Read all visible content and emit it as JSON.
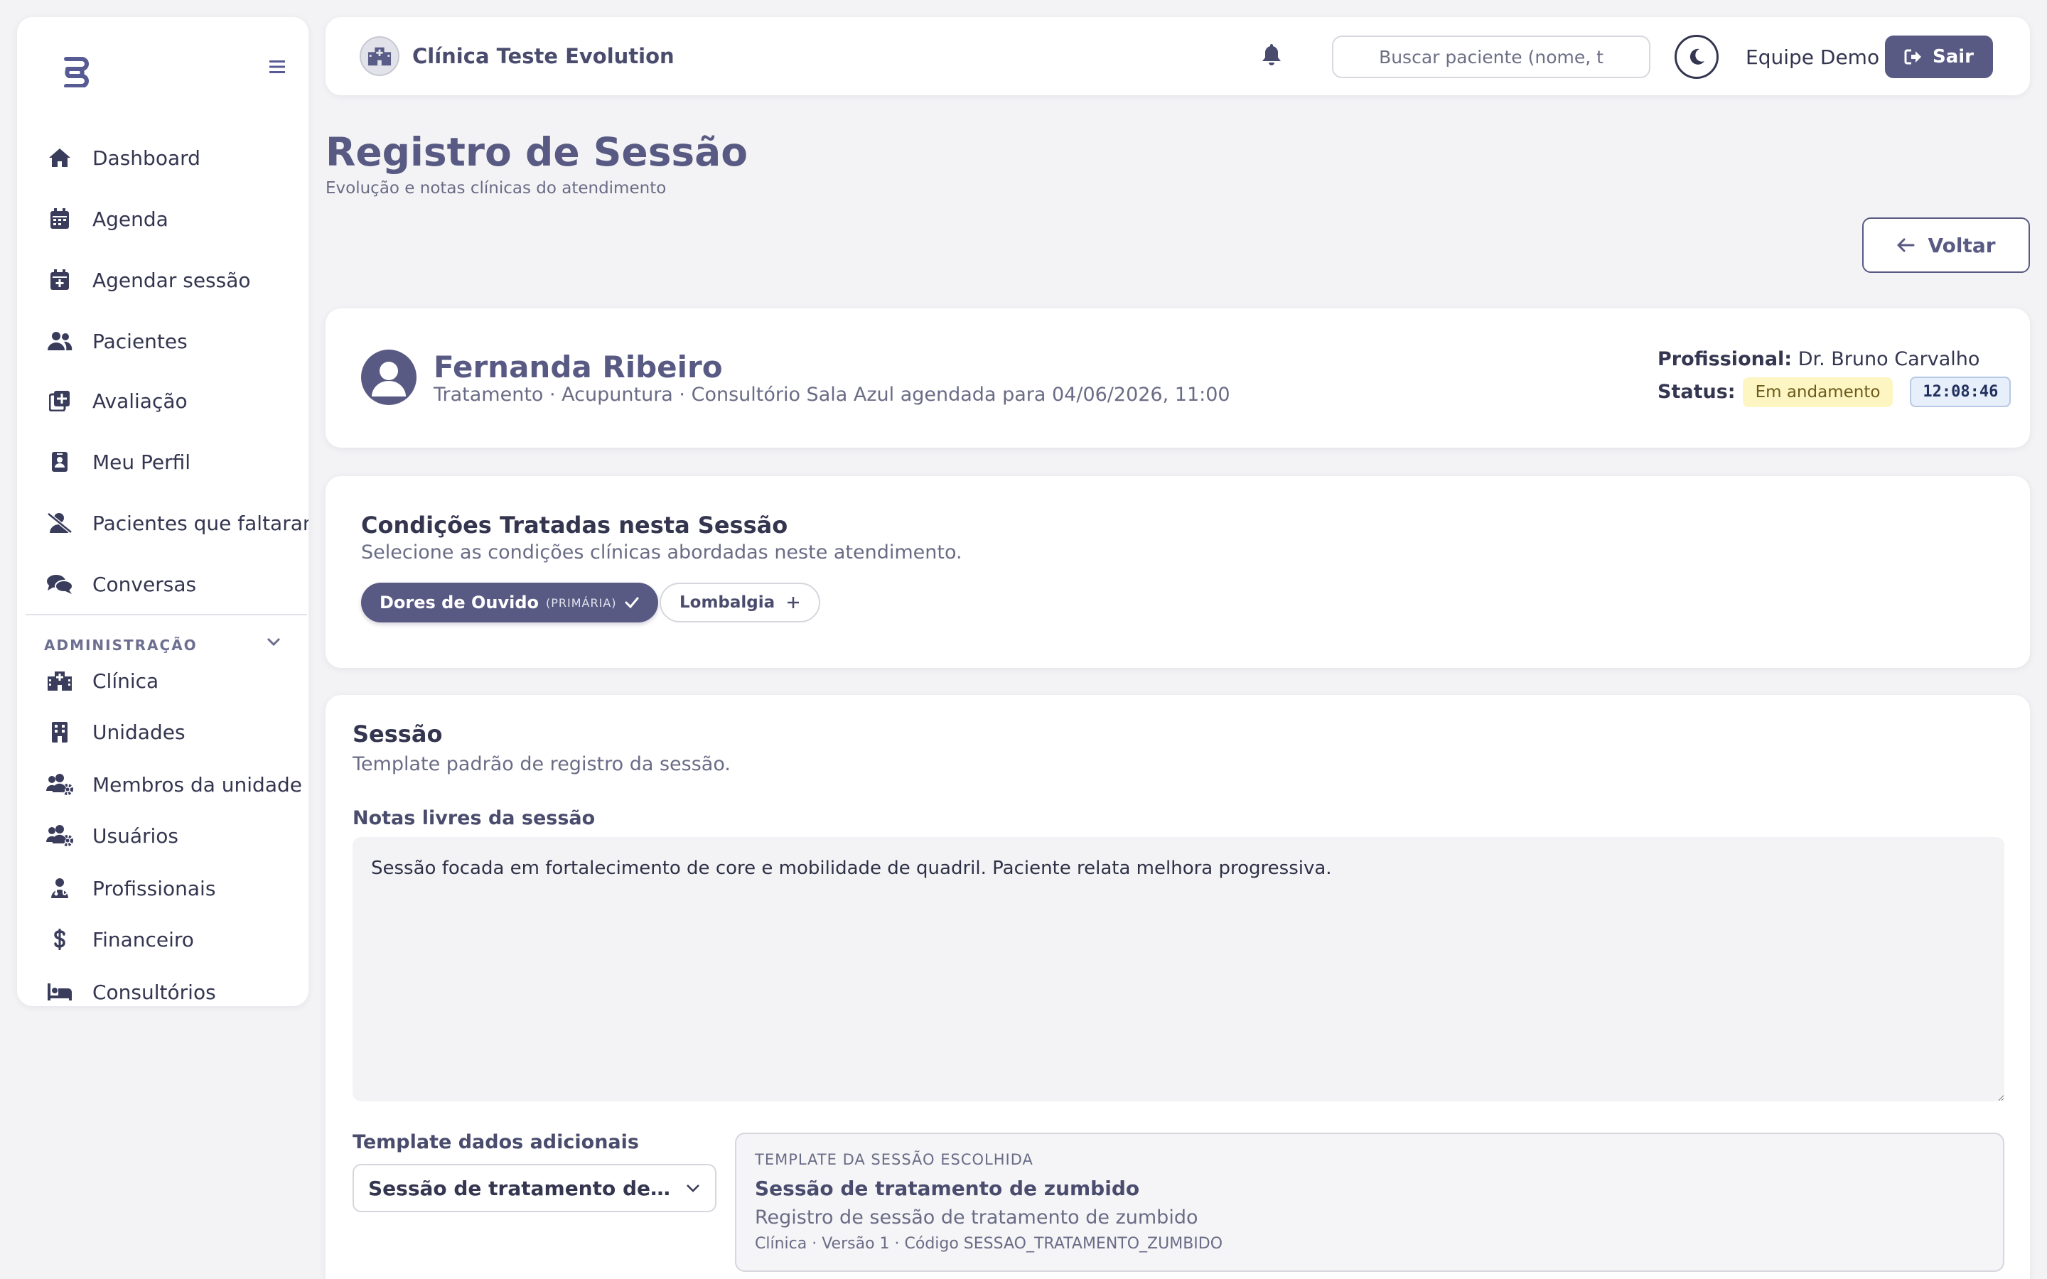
{
  "sidebar": {
    "logo_icon": "brand-logo-icon",
    "nav": [
      {
        "label": "Dashboard",
        "icon": "home-icon"
      },
      {
        "label": "Agenda",
        "icon": "calendar-icon"
      },
      {
        "label": "Agendar sessão",
        "icon": "calendar-plus-icon"
      },
      {
        "label": "Pacientes",
        "icon": "users-icon"
      },
      {
        "label": "Avaliação",
        "icon": "clipboard-plus-icon"
      },
      {
        "label": "Meu Perfil",
        "icon": "id-badge-icon"
      },
      {
        "label": "Pacientes que faltaram",
        "icon": "user-slash-icon"
      },
      {
        "label": "Conversas",
        "icon": "comments-icon"
      }
    ],
    "admin_section": "ADMINISTRAÇÃO",
    "admin": [
      {
        "label": "Clínica",
        "icon": "hospital-icon"
      },
      {
        "label": "Unidades",
        "icon": "building-icon"
      },
      {
        "label": "Membros da unidade",
        "icon": "users-gear-icon"
      },
      {
        "label": "Usuários",
        "icon": "users-gear-icon"
      },
      {
        "label": "Profissionais",
        "icon": "user-doctor-icon"
      },
      {
        "label": "Financeiro",
        "icon": "dollar-icon"
      },
      {
        "label": "Consultórios",
        "icon": "bed-icon"
      }
    ]
  },
  "header": {
    "clinic_name": "Clínica Teste Evolution",
    "search_placeholder": "Buscar paciente (nome, t",
    "user_name": "Equipe Demo",
    "logout_label": "Sair"
  },
  "page": {
    "title": "Registro de Sessão",
    "subtitle": "Evolução e notas clínicas do atendimento",
    "back_label": "Voltar"
  },
  "patient": {
    "name": "Fernanda Ribeiro",
    "info": "Tratamento · Acupuntura · Consultório Sala Azul agendada para 04/06/2026, 11:00",
    "professional_label": "Profissional:",
    "professional": "Dr. Bruno Carvalho",
    "status_label": "Status:",
    "status": "Em andamento",
    "timer": "12:08:46",
    "colors": {
      "status_bg": "#fdf6c3",
      "timer_bg": "#e6effa",
      "accent": "#585a83"
    }
  },
  "conditions": {
    "title": "Condições Tratadas nesta Sessão",
    "subtitle": "Selecione as condições clínicas abordadas neste atendimento.",
    "primary": {
      "label": "Dores de Ouvido",
      "tag": "(PRIMÁRIA)"
    },
    "other": {
      "label": "Lombalgia"
    }
  },
  "session": {
    "title": "Sessão",
    "subtitle": "Template padrão de registro da sessão.",
    "notes_label": "Notas livres da sessão",
    "notes_value": "Sessão focada em fortalecimento de core e mobilidade de quadril. Paciente relata melhora progressiva.",
    "template_label": "Template dados adicionais",
    "template_selected": "Sessão de tratamento de zumbido",
    "template_box": {
      "kicker": "TEMPLATE DA SESSÃO ESCOLHIDA",
      "name": "Sessão de tratamento de zumbido",
      "description": "Registro de sessão de tratamento de zumbido",
      "meta": "Clínica · Versão 1 · Código SESSAO_TRATAMENTO_ZUMBIDO"
    }
  }
}
